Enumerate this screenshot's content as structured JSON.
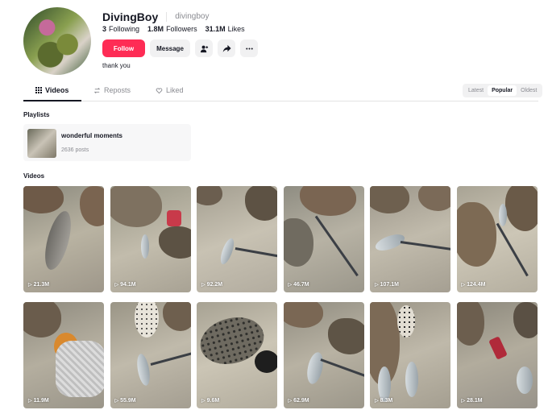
{
  "profile": {
    "display_name": "DivingBoy",
    "handle": "divingboy",
    "bio": "thank you",
    "stats": [
      {
        "value": "3",
        "label": "Following"
      },
      {
        "value": "1.8M",
        "label": "Followers"
      },
      {
        "value": "31.1M",
        "label": "Likes"
      }
    ]
  },
  "actions": {
    "follow": "Follow",
    "message": "Message"
  },
  "tabs": [
    {
      "label": "Videos",
      "icon": "grid-icon"
    },
    {
      "label": "Reposts",
      "icon": "repost-icon"
    },
    {
      "label": "Liked",
      "icon": "heart-lock-icon"
    }
  ],
  "sort": {
    "options": [
      "Latest",
      "Popular",
      "Oldest"
    ],
    "selected": "Popular"
  },
  "sections": {
    "playlists": "Playlists",
    "videos": "Videos"
  },
  "playlist": {
    "title": "wonderful moments",
    "count": "2636 posts"
  },
  "videos": [
    {
      "views": "21.3M"
    },
    {
      "views": "94.1M"
    },
    {
      "views": "92.2M"
    },
    {
      "views": "46.7M"
    },
    {
      "views": "107.1M"
    },
    {
      "views": "124.4M"
    },
    {
      "views": "11.9M"
    },
    {
      "views": "55.9M"
    },
    {
      "views": "9.6M"
    },
    {
      "views": "62.9M"
    },
    {
      "views": "8.3M"
    },
    {
      "views": "28.1M"
    }
  ],
  "colors": {
    "accent": "#fe2c55",
    "text": "#161823",
    "muted": "#8a8b91"
  }
}
